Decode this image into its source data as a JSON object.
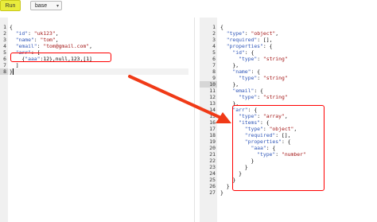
{
  "toolbar": {
    "run_label": "Run",
    "select_value": "base"
  },
  "left_editor": {
    "lines": [
      {
        "n": "1",
        "code": "{"
      },
      {
        "n": "2",
        "code": "  \"id\": \"uk123\","
      },
      {
        "n": "3",
        "code": "  \"name\": \"tom\","
      },
      {
        "n": "4",
        "code": "  \"email\": \"tom@gmail.com\","
      },
      {
        "n": "5",
        "code": "  \"arr\": ["
      },
      {
        "n": "6",
        "code": "    {\"aaa\":12},null,123,[1]"
      },
      {
        "n": "7",
        "code": "  ]"
      },
      {
        "n": "8",
        "code": "}"
      }
    ]
  },
  "right_editor": {
    "lines": [
      {
        "n": "1",
        "code": "{"
      },
      {
        "n": "2",
        "code": "  \"type\": \"object\","
      },
      {
        "n": "3",
        "code": "  \"required\": [],"
      },
      {
        "n": "4",
        "code": "  \"properties\": {"
      },
      {
        "n": "5",
        "code": "    \"id\": {"
      },
      {
        "n": "6",
        "code": "      \"type\": \"string\""
      },
      {
        "n": "7",
        "code": "    },"
      },
      {
        "n": "8",
        "code": "    \"name\": {"
      },
      {
        "n": "9",
        "code": "      \"type\": \"string\""
      },
      {
        "n": "10",
        "code": "    },"
      },
      {
        "n": "11",
        "code": "    \"email\": {"
      },
      {
        "n": "12",
        "code": "      \"type\": \"string\""
      },
      {
        "n": "13",
        "code": "    },"
      },
      {
        "n": "14",
        "code": "    \"arr\": {"
      },
      {
        "n": "15",
        "code": "      \"type\": \"array\","
      },
      {
        "n": "16",
        "code": "      \"items\": {"
      },
      {
        "n": "17",
        "code": "        \"type\": \"object\","
      },
      {
        "n": "18",
        "code": "        \"required\": [],"
      },
      {
        "n": "19",
        "code": "        \"properties\": {"
      },
      {
        "n": "20",
        "code": "          \"aaa\": {"
      },
      {
        "n": "21",
        "code": "            \"type\": \"number\""
      },
      {
        "n": "22",
        "code": "          }"
      },
      {
        "n": "23",
        "code": "        }"
      },
      {
        "n": "24",
        "code": "      }"
      },
      {
        "n": "25",
        "code": "    }"
      },
      {
        "n": "26",
        "code": "  }"
      },
      {
        "n": "27",
        "code": "}"
      }
    ]
  },
  "colors": {
    "run_button": "#e9ec3c",
    "annotation_red": "#ff0000",
    "key_blue": "#2f56b8",
    "string_red": "#a31515"
  }
}
